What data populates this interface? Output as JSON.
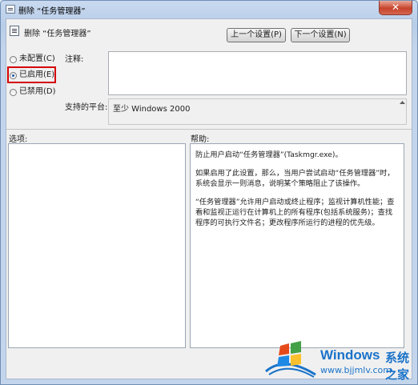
{
  "window": {
    "title": "删除 “任务管理器”",
    "close_glyph": "✕"
  },
  "header": {
    "title": "删除 “任务管理器”"
  },
  "buttons": {
    "prev": "上一个设置(P)",
    "next": "下一个设置(N)"
  },
  "radios": [
    {
      "label": "未配置(C)",
      "checked": false
    },
    {
      "label": "已启用(E)",
      "checked": true
    },
    {
      "label": "已禁用(D)",
      "checked": false
    }
  ],
  "labels": {
    "comment": "注释:",
    "supported": "支持的平台:",
    "options": "选项:",
    "help": "帮助:"
  },
  "supported_value": "至少 Windows 2000",
  "help_text": [
    "防止用户启动“任务管理器”(Taskmgr.exe)。",
    "如果启用了此设置，那么，当用户尝试启动“任务管理器”时，系统会显示一则消息，说明某个策略阻止了该操作。",
    "“任务管理器”允许用户启动或终止程序；监视计算机性能；查看和监视正运行在计算机上的所有程序(包括系统服务)；查找程序的可执行文件名；更改程序所运行的进程的优先级。"
  ],
  "watermark": {
    "brand": "Windows",
    "cn": "系统之家",
    "url": "www.bjjmlv.com"
  },
  "colors": {
    "highlight": "#d40000",
    "watermark": "#1a73c9"
  }
}
